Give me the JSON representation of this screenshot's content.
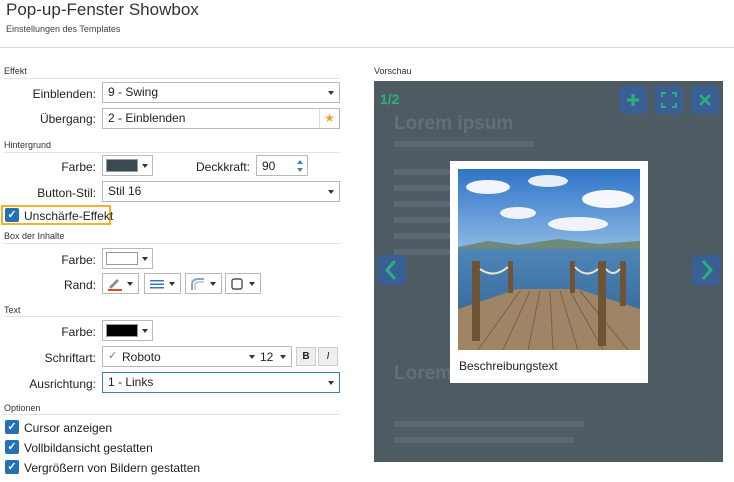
{
  "header": {
    "title": "Pop-up-Fenster Showbox",
    "subtitle": "Einstellungen des Templates"
  },
  "effekt": {
    "section": "Effekt",
    "einblenden_label": "Einblenden:",
    "einblenden_value": "9 - Swing",
    "uebergang_label": "Übergang:",
    "uebergang_value": "2 - Einblenden"
  },
  "hintergrund": {
    "section": "Hintergrund",
    "farbe_label": "Farbe:",
    "farbe_color": "#3a4a55",
    "deckkraft_label": "Deckkraft:",
    "deckkraft_value": "90",
    "buttonstil_label": "Button-Stil:",
    "buttonstil_value": "Stil 16",
    "unschaerfe_label": "Unschärfe-Effekt",
    "unschaerfe_checked": true
  },
  "box": {
    "section": "Box der Inhalte",
    "farbe_label": "Farbe:",
    "farbe_color": "#ffffff",
    "rand_label": "Rand:"
  },
  "text": {
    "section": "Text",
    "farbe_label": "Farbe:",
    "farbe_color": "#000000",
    "schriftart_label": "Schriftart:",
    "schriftart_value": "Roboto",
    "schriftgroesse": "12",
    "bold_label": "B",
    "italic_label": "I",
    "ausrichtung_label": "Ausrichtung:",
    "ausrichtung_value": "1 - Links"
  },
  "optionen": {
    "section": "Optionen",
    "items": [
      {
        "label": "Cursor anzeigen",
        "checked": true
      },
      {
        "label": "Vollbildansicht gestatten",
        "checked": true
      },
      {
        "label": "Vergrößern von Bildern gestatten",
        "checked": true
      }
    ]
  },
  "vorschau": {
    "section": "Vorschau",
    "counter": "1/2",
    "caption": "Beschreibungstext",
    "ghost_title_1": "Lorem ipsum",
    "ghost_title_2": "Lorem",
    "background_color": "#4f5b63",
    "accent_color": "#2ab27b",
    "button_color": "#3a5f95",
    "icons": {
      "add": "plus-icon",
      "fullscreen": "fullscreen-icon",
      "close": "close-icon",
      "prev": "chevron-left-icon",
      "next": "chevron-right-icon"
    }
  }
}
